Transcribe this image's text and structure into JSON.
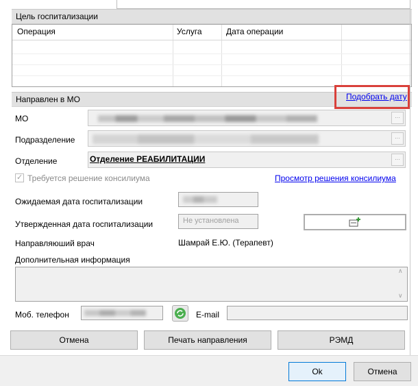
{
  "purpose_section": {
    "title": "Цель госпитализации",
    "columns": [
      "Операция",
      "Услуга",
      "Дата операции"
    ]
  },
  "referral_section": {
    "title": "Направлен в МО",
    "pick_date_link": "Подобрать дату",
    "mo_label": "МО",
    "subdivision_label": "Подразделение",
    "department_label": "Отделение",
    "department_value": "Отделение РЕАБИЛИТАЦИИ",
    "council_checkbox_label": "Требуется решение консилиума",
    "council_checked": true,
    "view_council_link": "Просмотр решения консилиума",
    "expected_date_label": "Ожидаемая дата госпитализации",
    "approved_date_label": "Утвержденная дата госпитализации",
    "approved_date_placeholder": "Не установлена",
    "referring_doctor_label": "Направляюший врач",
    "referring_doctor_value": "Шамрай Е.Ю. (Терапевт)",
    "additional_info_label": "Дополнительная информация",
    "phone_label": "Моб. телефон",
    "email_label": "E-mail"
  },
  "actions": {
    "cancel_label": "Отмена",
    "print_label": "Печать направления",
    "remd_label": "РЭМД"
  },
  "dialog_footer": {
    "ok_label": "Ok",
    "cancel_label": "Отмена"
  },
  "highlight_color": "#d9403a",
  "link_color": "#0000ee"
}
